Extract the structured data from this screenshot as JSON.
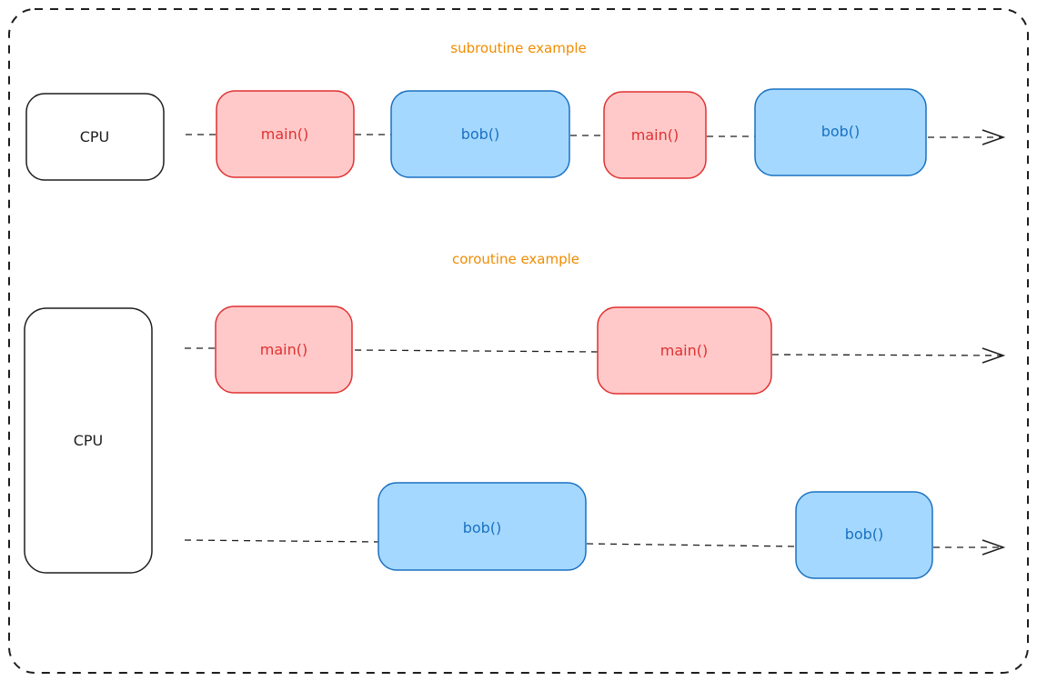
{
  "colors": {
    "title": "#f08c00",
    "main_fill": "#ffc9c9",
    "main_stroke": "#e03131",
    "main_text": "#e03131",
    "bob_fill": "#a5d8ff",
    "bob_stroke": "#1971c2",
    "bob_text": "#1971c2",
    "cpu_stroke": "#1e1e1e",
    "cpu_text": "#1e1e1e",
    "line": "#1e1e1e"
  },
  "frame": {
    "style": "dashed",
    "label": ""
  },
  "subroutine": {
    "title": "subroutine example",
    "cpu_label": "CPU",
    "blocks": [
      {
        "label": "main()",
        "kind": "main"
      },
      {
        "label": "bob()",
        "kind": "bob"
      },
      {
        "label": "main()",
        "kind": "main"
      },
      {
        "label": "bob()",
        "kind": "bob"
      }
    ]
  },
  "coroutine": {
    "title": "coroutine example",
    "cpu_label": "CPU",
    "main_track": [
      {
        "label": "main()",
        "kind": "main"
      },
      {
        "label": "main()",
        "kind": "main"
      }
    ],
    "bob_track": [
      {
        "label": "bob()",
        "kind": "bob"
      },
      {
        "label": "bob()",
        "kind": "bob"
      }
    ]
  }
}
